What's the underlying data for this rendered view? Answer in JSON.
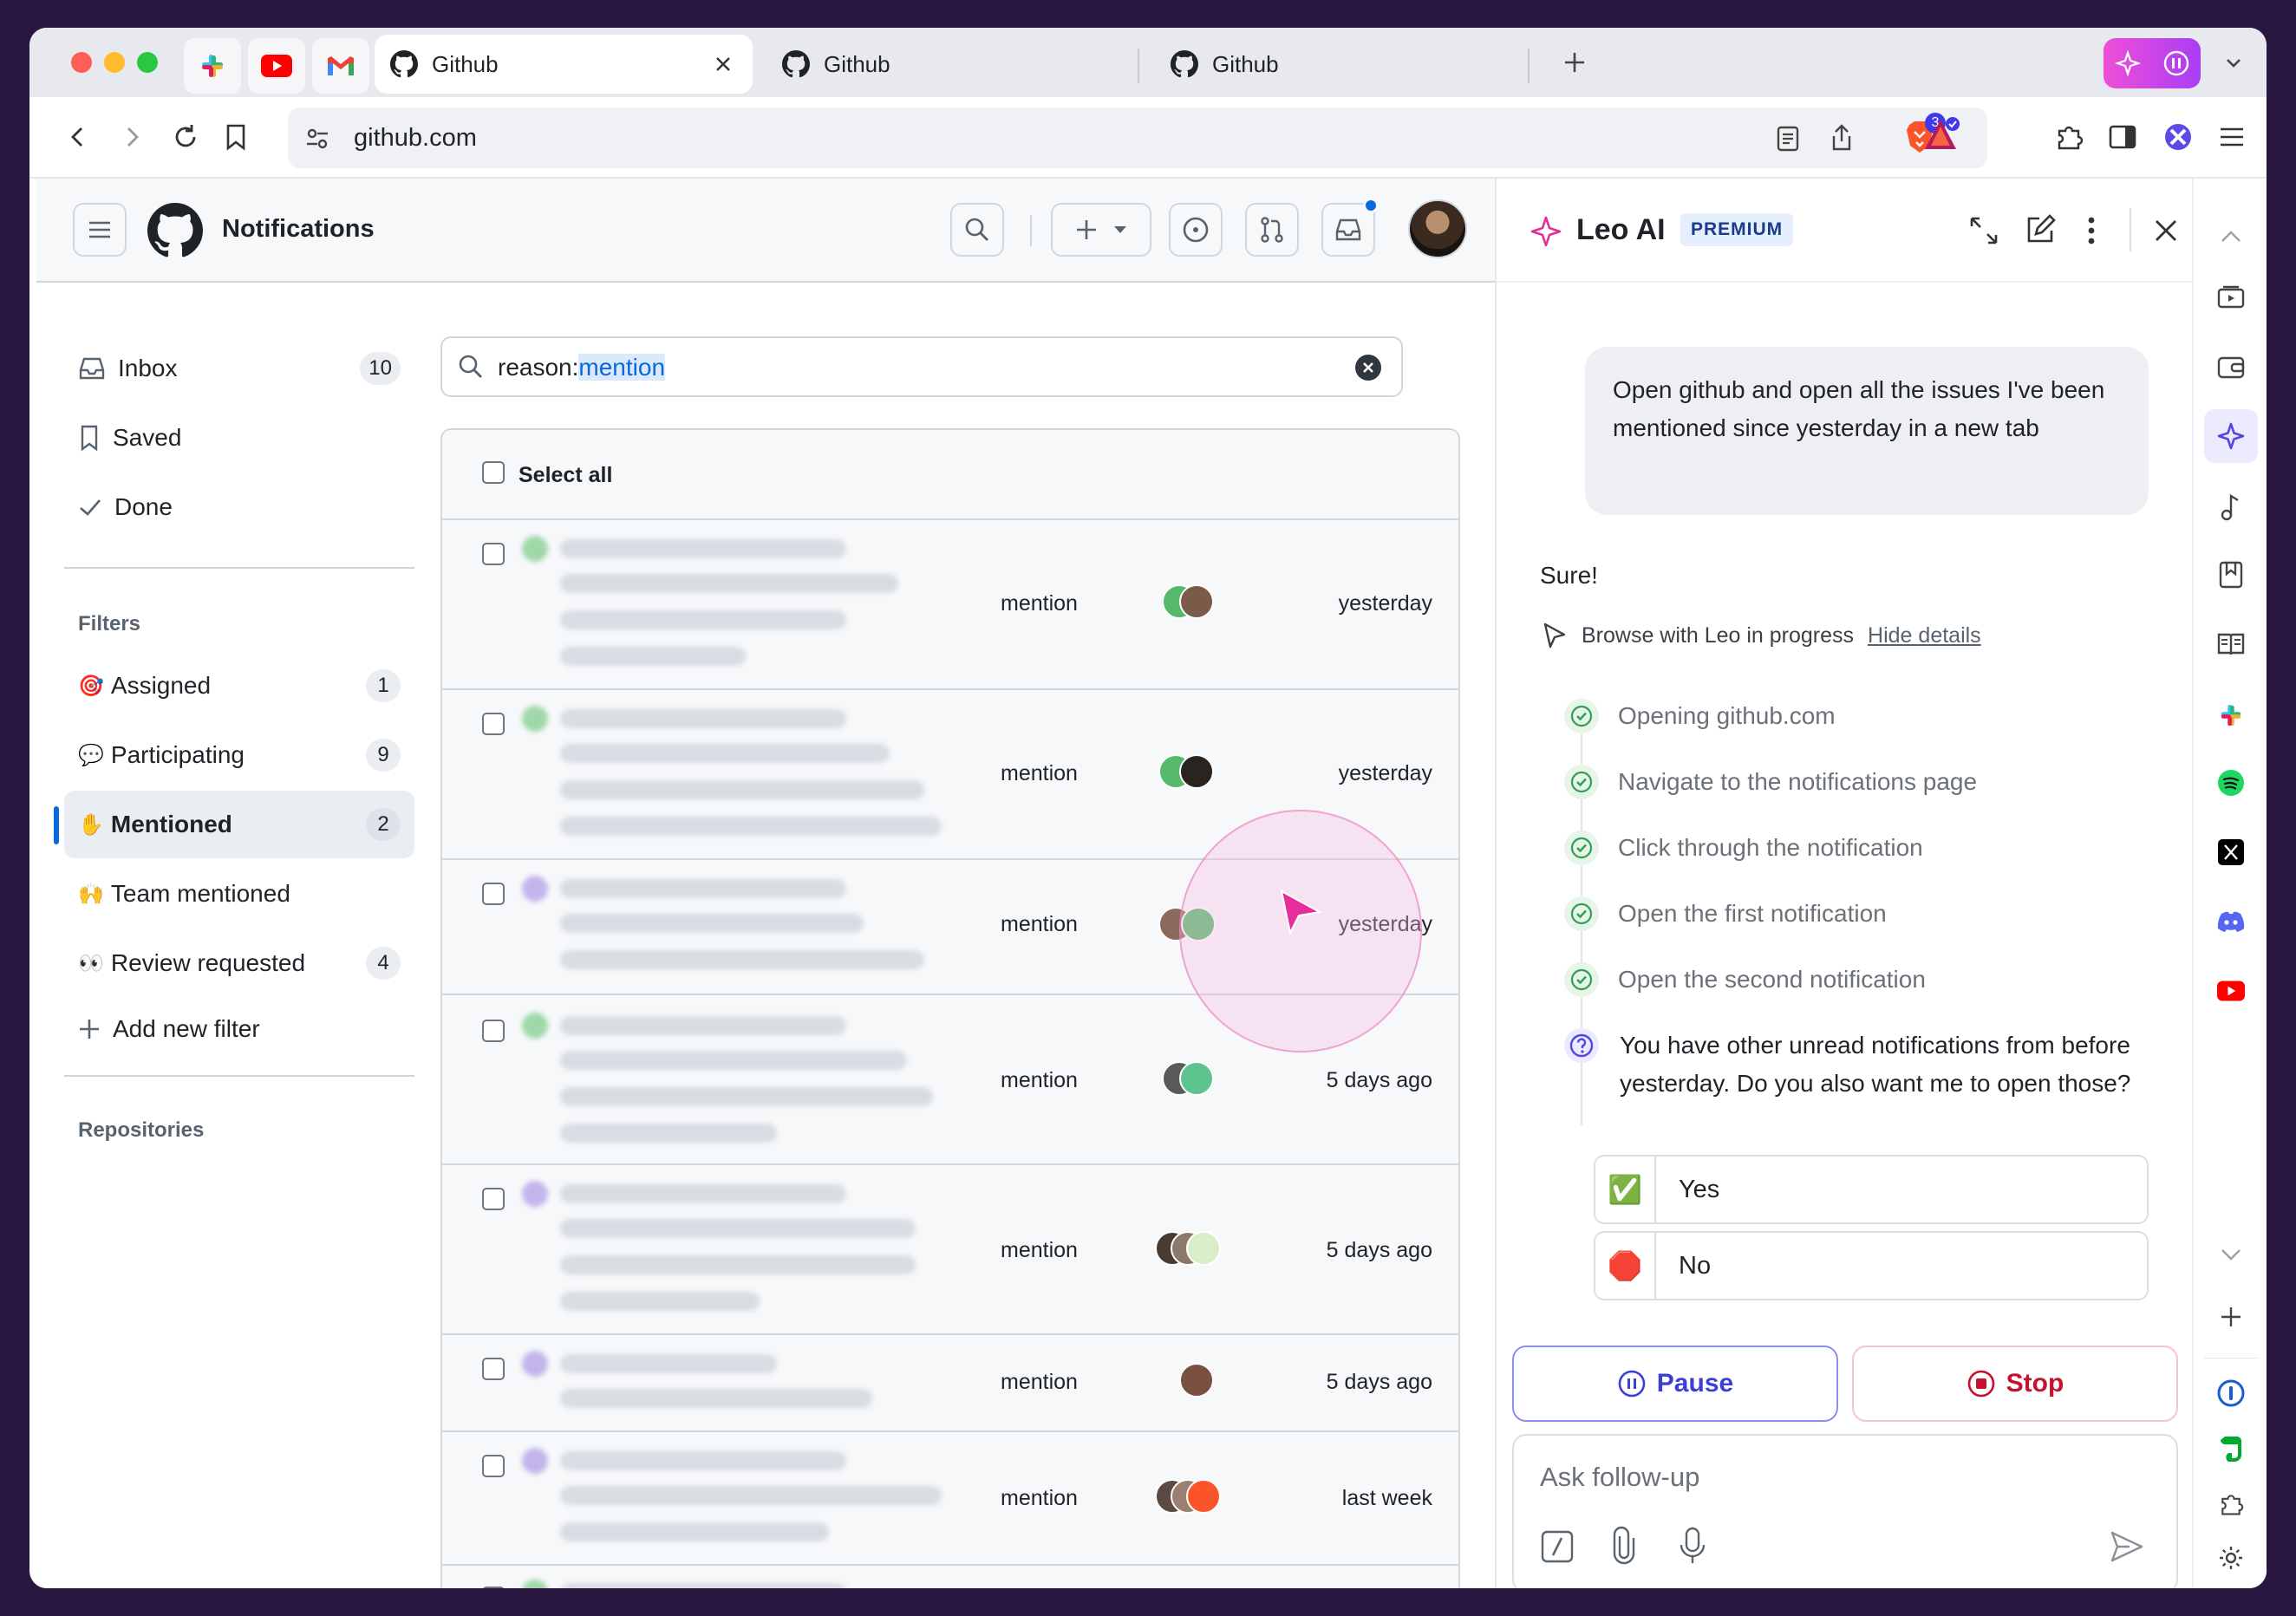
{
  "browser": {
    "tabs": [
      {
        "title": "Github",
        "active": true
      },
      {
        "title": "Github",
        "active": false
      },
      {
        "title": "Github",
        "active": false
      }
    ],
    "url": "github.com",
    "brave_shield_count": "3",
    "colors": {
      "accent": "#f04fd6",
      "frame": "#2a1740"
    }
  },
  "github": {
    "page_title": "Notifications",
    "sidebar": {
      "inbox": {
        "label": "Inbox",
        "count": "10"
      },
      "saved": {
        "label": "Saved"
      },
      "done": {
        "label": "Done"
      },
      "filters_heading": "Filters",
      "filters": [
        {
          "emoji": "🎯",
          "label": "Assigned",
          "count": "1"
        },
        {
          "emoji": "💬",
          "label": "Participating",
          "count": "9"
        },
        {
          "emoji": "✋",
          "label": "Mentioned",
          "count": "2",
          "selected": true
        },
        {
          "emoji": "🙌",
          "label": "Team mentioned",
          "count": ""
        },
        {
          "emoji": "👀",
          "label": "Review requested",
          "count": "4"
        }
      ],
      "add_filter": "Add new filter",
      "repos_heading": "Repositories"
    },
    "search": {
      "prefix": "reason:",
      "term": "mention"
    },
    "select_all": "Select all",
    "rows": [
      {
        "reason": "mention",
        "time": "yesterday"
      },
      {
        "reason": "mention",
        "time": "yesterday"
      },
      {
        "reason": "mention",
        "time": "yesterday"
      },
      {
        "reason": "mention",
        "time": "5 days ago"
      },
      {
        "reason": "mention",
        "time": "5 days ago"
      },
      {
        "reason": "mention",
        "time": "5 days ago"
      },
      {
        "reason": "mention",
        "time": "last week"
      },
      {
        "reason": "",
        "time": ""
      }
    ]
  },
  "leo": {
    "title": "Leo AI",
    "badge": "PREMIUM",
    "user_message": "Open github and open all the issues I've been mentioned since yesterday in a new tab",
    "reply": "Sure!",
    "progress_label": "Browse with Leo in progress",
    "hide_details": "Hide details",
    "steps": [
      "Opening github.com",
      "Navigate to the notifications page",
      "Click through the notification",
      "Open the first notification",
      "Open the second notification"
    ],
    "question": "You have other unread notifications from before yesterday. Do you also want me to open those?",
    "choices": [
      {
        "emoji": "✅",
        "label": "Yes"
      },
      {
        "emoji": "🛑",
        "label": "No"
      }
    ],
    "pause_label": "Pause",
    "stop_label": "Stop",
    "input_placeholder": "Ask follow-up"
  }
}
